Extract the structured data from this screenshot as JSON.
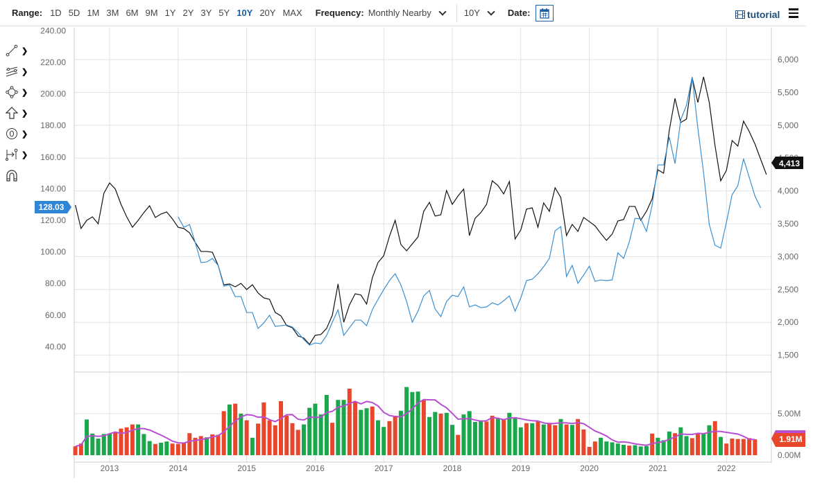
{
  "toolbar": {
    "range_label": "Range:",
    "ranges": [
      "1D",
      "5D",
      "1M",
      "3M",
      "6M",
      "9M",
      "1Y",
      "2Y",
      "3Y",
      "5Y",
      "10Y",
      "20Y",
      "MAX"
    ],
    "active_range": "10Y",
    "frequency_label": "Frequency:",
    "frequency_value": "Monthly Nearby",
    "period_value": "10Y",
    "date_label": "Date:",
    "tutorial_label": "tutorial"
  },
  "tools": [
    "line-tool-icon",
    "channel-tool-icon",
    "shape-tool-icon",
    "arrow-tool-icon",
    "text-label-tool-icon",
    "measure-tool-icon",
    "magnet-icon"
  ],
  "colors": {
    "primary": "#111111",
    "compare": "#3a8fd1",
    "up": "#1aa64b",
    "down": "#e8472b",
    "ma": "#b84fd0",
    "tag_blue": "#2f86d6"
  },
  "chart_data": {
    "type": "line",
    "x_start": 2012.5,
    "x_step_months": 1,
    "x_ticks": [
      "2013",
      "2014",
      "2015",
      "2016",
      "2017",
      "2018",
      "2019",
      "2020",
      "2021",
      "2022"
    ],
    "left_axis": {
      "ticks": [
        "240.00",
        "220.00",
        "200.00",
        "180.00",
        "160.00",
        "140.00",
        "120.00",
        "100.00",
        "80.00",
        "60.00",
        "40.00"
      ],
      "range": [
        40,
        240
      ]
    },
    "right_axis": {
      "ticks": [
        "6,000",
        "5,500",
        "5,000",
        "4,500",
        "4,000",
        "3,500",
        "3,000",
        "2,500",
        "2,000",
        "1,500"
      ],
      "range": [
        1500,
        6000
      ]
    },
    "grid": true,
    "series": [
      {
        "name": "primary",
        "axis": "left",
        "start": 2012.5,
        "last_label": "128.03",
        "values": [
          129.7,
          114.8,
          120.0,
          122.2,
          117.8,
          137.1,
          143.7,
          139.8,
          130.1,
          122.2,
          115.6,
          120.0,
          124.9,
          129.2,
          121.8,
          124.0,
          125.3,
          120.9,
          115.6,
          114.8,
          112.1,
          106.0,
          100.3,
          100.3,
          99.8,
          91.5,
          79.2,
          79.7,
          77.9,
          80.1,
          76.2,
          79.2,
          74.0,
          70.9,
          70.0,
          61.7,
          59.5,
          53.4,
          52.0,
          46.8,
          45.5,
          41.5,
          47.2,
          47.7,
          51.6,
          59.9,
          79.7,
          55.5,
          66.5,
          73.5,
          72.7,
          67.0,
          83.6,
          93.3,
          97.6,
          109.9,
          120.0,
          104.7,
          100.7,
          105.1,
          109.5,
          125.7,
          131.4,
          122.7,
          123.5,
          138.9,
          130.1,
          135.4,
          139.8,
          110.4,
          121.3,
          124.9,
          130.1,
          145.0,
          142.0,
          136.7,
          144.6,
          108.2,
          113.9,
          127.1,
          127.9,
          115.6,
          131.0,
          125.7,
          140.6,
          134.5,
          110.4,
          117.4,
          113.0,
          121.8,
          119.2,
          116.5,
          111.7,
          107.3,
          111.3,
          119.6,
          120.5,
          128.8,
          128.8,
          120.0,
          125.7,
          133.6,
          152.0,
          149.8,
          177.0,
          197.2,
          181.9,
          184.1,
          210.4,
          194.6,
          210.8,
          194.6,
          167.4,
          145.0,
          151.6,
          170.5,
          167.0,
          182.8,
          176.2,
          168.3,
          158.6,
          149.0
        ]
      },
      {
        "name": "compare",
        "axis": "right",
        "start": 2014.0,
        "last_label": "4,413",
        "values": [
          3605,
          3447,
          3489,
          3215,
          2909,
          2919,
          2972,
          2867,
          2550,
          2571,
          2392,
          2392,
          2149,
          2149,
          1907,
          1991,
          2107,
          1938,
          1949,
          1959,
          1928,
          1843,
          1738,
          1653,
          1685,
          1674,
          1801,
          2002,
          2191,
          1801,
          1917,
          2033,
          2033,
          1949,
          2191,
          2350,
          2497,
          2635,
          2740,
          2571,
          2318,
          2002,
          2170,
          2402,
          2486,
          2202,
          2086,
          2318,
          2413,
          2392,
          2540,
          2234,
          2265,
          2223,
          2234,
          2297,
          2265,
          2328,
          2402,
          2170,
          2371,
          2635,
          2656,
          2740,
          2846,
          2972,
          3394,
          3457,
          2698,
          2867,
          2592,
          2719,
          2856,
          2624,
          2645,
          2635,
          2645,
          3057,
          2972,
          3225,
          3584,
          3574,
          3384,
          3784,
          4396,
          4396,
          4818,
          4417,
          5082,
          5304,
          5736,
          4956,
          4280,
          3489,
          3173,
          3131,
          3521,
          3943,
          4080,
          4491,
          4206,
          3922,
          3742
        ]
      }
    ],
    "volume": {
      "axis_ticks": [
        "5.00M",
        "0.00M"
      ],
      "last_label": "1.91M",
      "values": [
        1.06,
        1.4,
        4.3,
        2.6,
        2.0,
        2.55,
        2.6,
        2.7,
        3.2,
        3.35,
        3.7,
        3.7,
        2.55,
        1.7,
        1.35,
        1.5,
        1.65,
        1.4,
        1.35,
        1.5,
        2.65,
        2.1,
        2.3,
        2.15,
        2.5,
        2.45,
        5.3,
        6.1,
        6.2,
        5.0,
        4.2,
        2.1,
        3.8,
        6.35,
        4.2,
        3.6,
        6.5,
        4.75,
        3.85,
        3.05,
        3.7,
        5.7,
        6.2,
        4.9,
        7.25,
        3.9,
        6.65,
        6.65,
        8.0,
        6.4,
        5.45,
        5.65,
        5.85,
        4.2,
        3.4,
        4.1,
        4.75,
        5.35,
        8.2,
        7.6,
        7.65,
        6.6,
        4.6,
        5.2,
        5.0,
        5.1,
        3.65,
        2.45,
        4.9,
        5.3,
        4.0,
        4.2,
        4.05,
        4.75,
        4.4,
        4.25,
        5.1,
        4.5,
        3.35,
        3.85,
        3.85,
        4.05,
        3.7,
        3.9,
        3.6,
        4.35,
        3.7,
        3.65,
        4.35,
        3.1,
        1.0,
        1.65,
        2.1,
        1.65,
        1.55,
        1.4,
        1.25,
        1.15,
        1.2,
        1.05,
        1.1,
        2.6,
        2.1,
        1.8,
        2.85,
        2.65,
        3.35,
        2.3,
        2.05,
        2.6,
        2.6,
        3.6,
        4.1,
        2.2,
        1.4,
        2.0,
        1.95,
        1.95,
        2.05,
        1.91
      ],
      "direction": "rrgggggrrrrgggrggrrrrrrgrrrgrgrgrrrrrrrrgggggrggrrggrggrrggggrggrggrggggrrgrgggrgrgrrgrgrrrrgggggrgggrgggrggrrggrgrrr"
    }
  }
}
